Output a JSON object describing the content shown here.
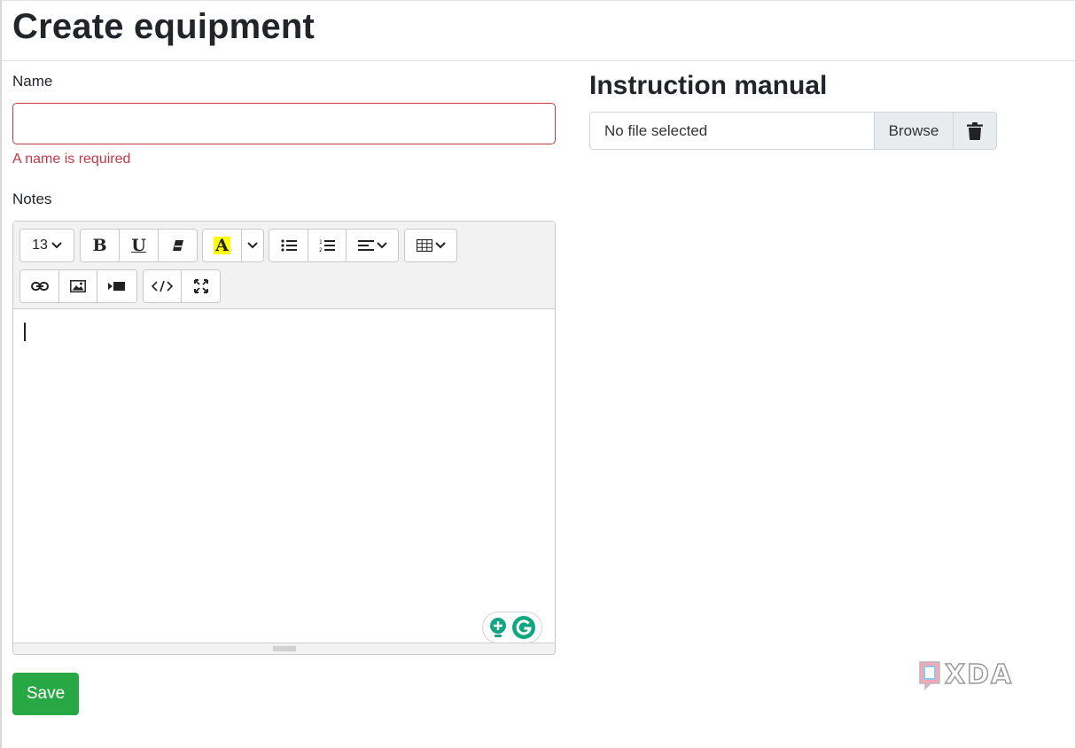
{
  "page": {
    "title": "Create equipment"
  },
  "form": {
    "name_label": "Name",
    "name_value": "",
    "name_error": "A name is required",
    "notes_label": "Notes",
    "save_label": "Save"
  },
  "editor": {
    "font_size": "13",
    "toolbar_row1": [
      "font-size-dropdown",
      "bold",
      "underline",
      "clear-format",
      "text-color",
      "color-dropdown",
      "unordered-list",
      "ordered-list",
      "paragraph-align",
      "table"
    ],
    "toolbar_row2": [
      "link",
      "picture",
      "video",
      "code-view",
      "fullscreen"
    ],
    "bold_glyph": "B",
    "underline_glyph": "U",
    "color_glyph": "A",
    "highlight_color": "#ffff00",
    "content": ""
  },
  "manual": {
    "title": "Instruction manual",
    "file_text": "No file selected",
    "browse_label": "Browse"
  },
  "watermark": {
    "text": "XDA"
  },
  "colors": {
    "error": "#c0394a",
    "save_button": "#28a745",
    "grammarly": "#11a683"
  }
}
